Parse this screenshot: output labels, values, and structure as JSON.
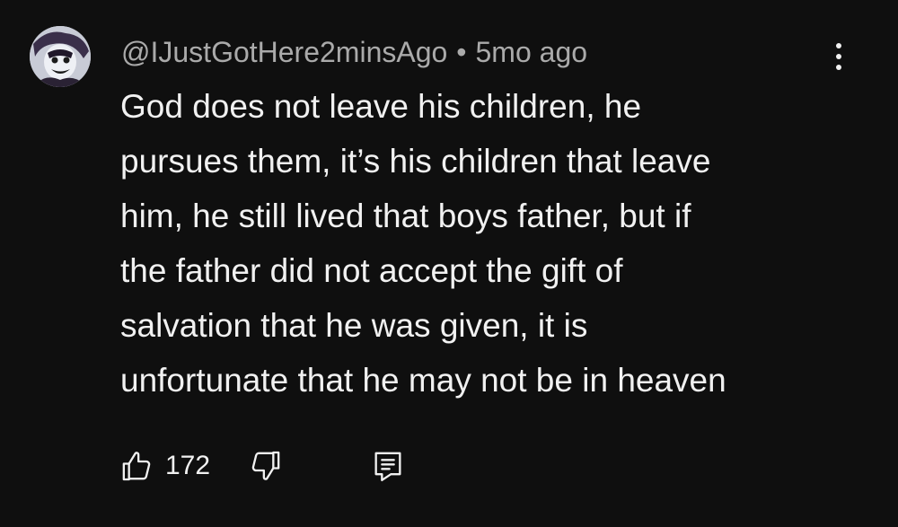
{
  "comment": {
    "author": "@IJustGotHere2minsAgo",
    "separator": "•",
    "timestamp": "5mo ago",
    "text_lines": [
      "God does not leave his children, he",
      "pursues them, it’s his children that leave",
      "him, he still lived that boys father, but if",
      "the father did not accept the gift of",
      "salvation that he was given, it is",
      "unfortunate that he may not be in heaven"
    ],
    "like_count": "172"
  },
  "icons": {
    "avatar": "masked-character-avatar",
    "menu": "more-vertical-icon",
    "like": "thumbs-up-icon",
    "dislike": "thumbs-down-icon",
    "reply": "comment-reply-icon"
  },
  "colors": {
    "background": "#0f0f0f",
    "primary_text": "#f1f1f1",
    "secondary_text": "#aaaaaa"
  }
}
